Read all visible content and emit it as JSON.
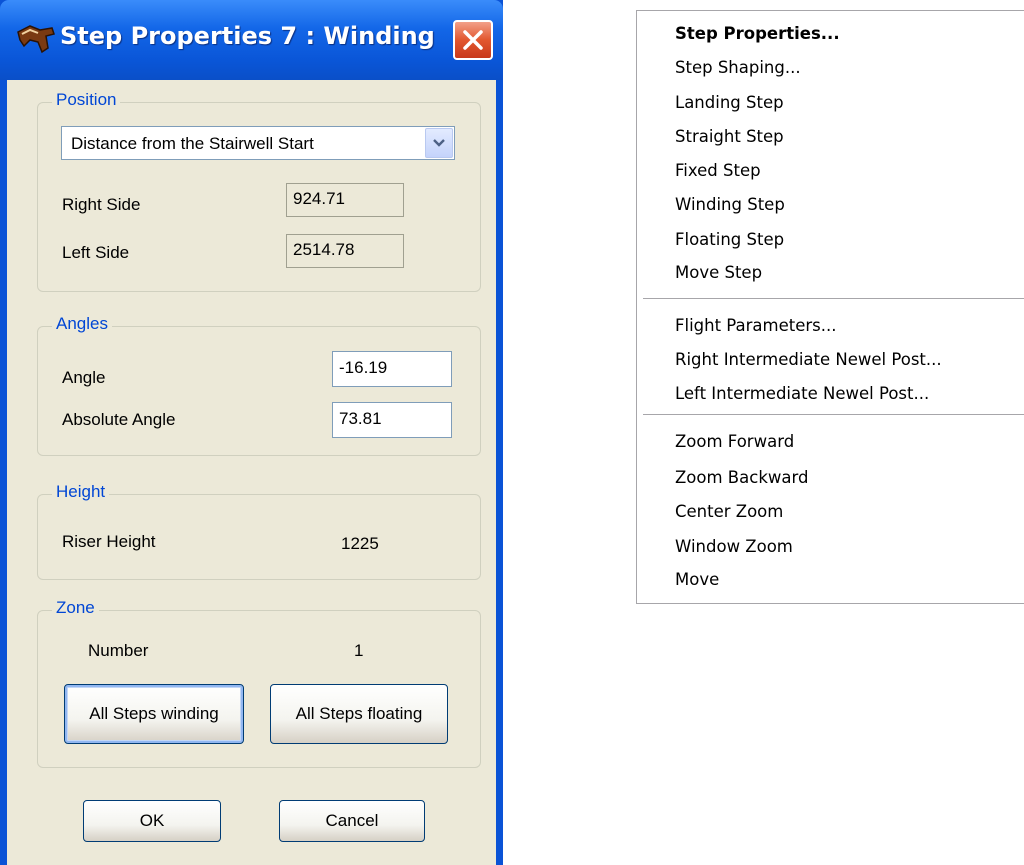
{
  "dialog": {
    "title": "Step Properties 7 : Winding",
    "position": {
      "group_label": "Position",
      "reference_option": "Distance from the Stairwell Start",
      "right_side_label": "Right Side",
      "right_side_value": "924.71",
      "left_side_label": "Left Side",
      "left_side_value": "2514.78"
    },
    "angles": {
      "group_label": "Angles",
      "angle_label": "Angle",
      "angle_value": "-16.19",
      "absolute_angle_label": "Absolute Angle",
      "absolute_angle_value": "73.81"
    },
    "height": {
      "group_label": "Height",
      "riser_height_label": "Riser Height",
      "riser_height_value": "1225"
    },
    "zone": {
      "group_label": "Zone",
      "number_label": "Number",
      "number_value": "1",
      "all_winding_label": "All Steps winding",
      "all_floating_label": "All Steps floating"
    },
    "ok_label": "OK",
    "cancel_label": "Cancel"
  },
  "context_menu": {
    "items": [
      "Step Properties...",
      "Step Shaping...",
      "Landing Step",
      "Straight Step",
      "Fixed Step",
      "Winding Step",
      "Floating Step",
      "Move Step",
      "Flight Parameters...",
      "Right Intermediate Newel Post...",
      "Left Intermediate Newel Post...",
      "Zoom Forward",
      "Zoom Backward",
      "Center Zoom",
      "Window Zoom",
      "Move"
    ]
  },
  "colors": {
    "title_bar": "#0a56d8",
    "group_label_text": "#0046d5",
    "dialog_face": "#ece9d8",
    "close_button": "#e2572f"
  }
}
